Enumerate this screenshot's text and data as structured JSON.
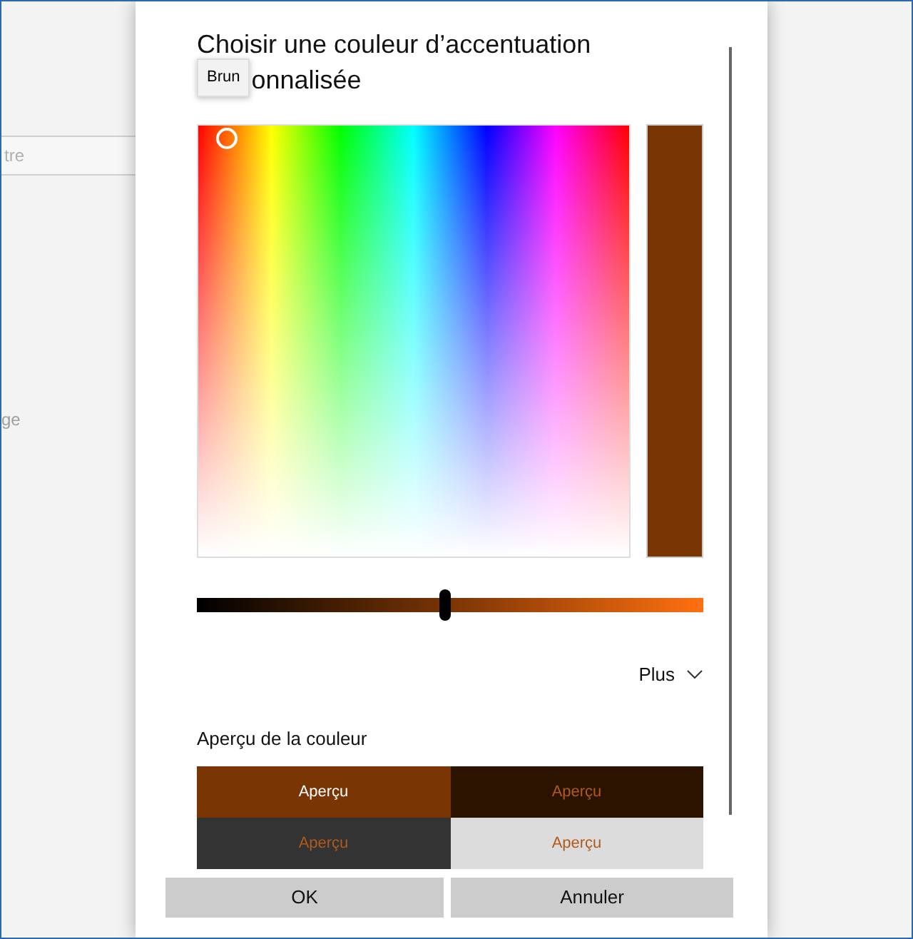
{
  "background": {
    "field_text": "tre",
    "label_text": "ge"
  },
  "dialog": {
    "title_line_1": "Choisir une couleur d’accentuation",
    "title_line_2": "onnalisée",
    "tooltip": "Brun",
    "swatch": {
      "color": "#7a3505"
    },
    "brightness": {
      "level": 0.49
    },
    "more": {
      "label": "Plus",
      "expanded": false
    },
    "preview_label": "Aperçu de la couleur",
    "previews": [
      {
        "text": "Aperçu",
        "color": "#7a3505",
        "kind": "white_text"
      },
      {
        "text": "Aperçu",
        "color": "#2b1300",
        "kind": "accent_text"
      },
      {
        "text": "Aperçu",
        "color": "#333333",
        "kind": "accent_text"
      },
      {
        "text": "Aperçu",
        "color": "#dcdcdc",
        "kind": "accent_text"
      }
    ],
    "buttons": [
      "OK",
      "Annuler"
    ]
  }
}
